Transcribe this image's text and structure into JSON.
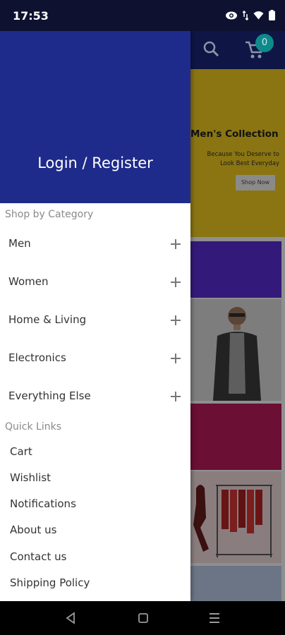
{
  "status_bar": {
    "time": "17:53",
    "icons": [
      "eye-icon",
      "data-arrows-icon",
      "wifi-icon",
      "battery-icon"
    ]
  },
  "app": {
    "header_icons": [
      "search-icon",
      "cart-icon"
    ],
    "cart_count": "0",
    "banner": {
      "title": "Men's Collection",
      "subtitle": "Because You Deserve to Look Best Everyday",
      "button": "Shop Now"
    }
  },
  "drawer": {
    "login_label": "Login / Register",
    "shop_by_category_label": "Shop by Category",
    "categories": [
      {
        "label": "Men"
      },
      {
        "label": "Women"
      },
      {
        "label": "Home & Living"
      },
      {
        "label": "Electronics"
      },
      {
        "label": "Everything Else"
      }
    ],
    "quick_links_label": "Quick Links",
    "quick_links": [
      {
        "label": "Cart"
      },
      {
        "label": "Wishlist"
      },
      {
        "label": "Notifications"
      },
      {
        "label": "About us"
      },
      {
        "label": "Contact us"
      },
      {
        "label": "Shipping Policy"
      }
    ]
  },
  "nav_bar": {
    "buttons": [
      "back-icon",
      "home-icon",
      "recents-icon"
    ]
  },
  "colors": {
    "drawer_header": "#1f2b8a",
    "app_header": "#0f1645",
    "cart_badge": "#0f8a8a"
  }
}
